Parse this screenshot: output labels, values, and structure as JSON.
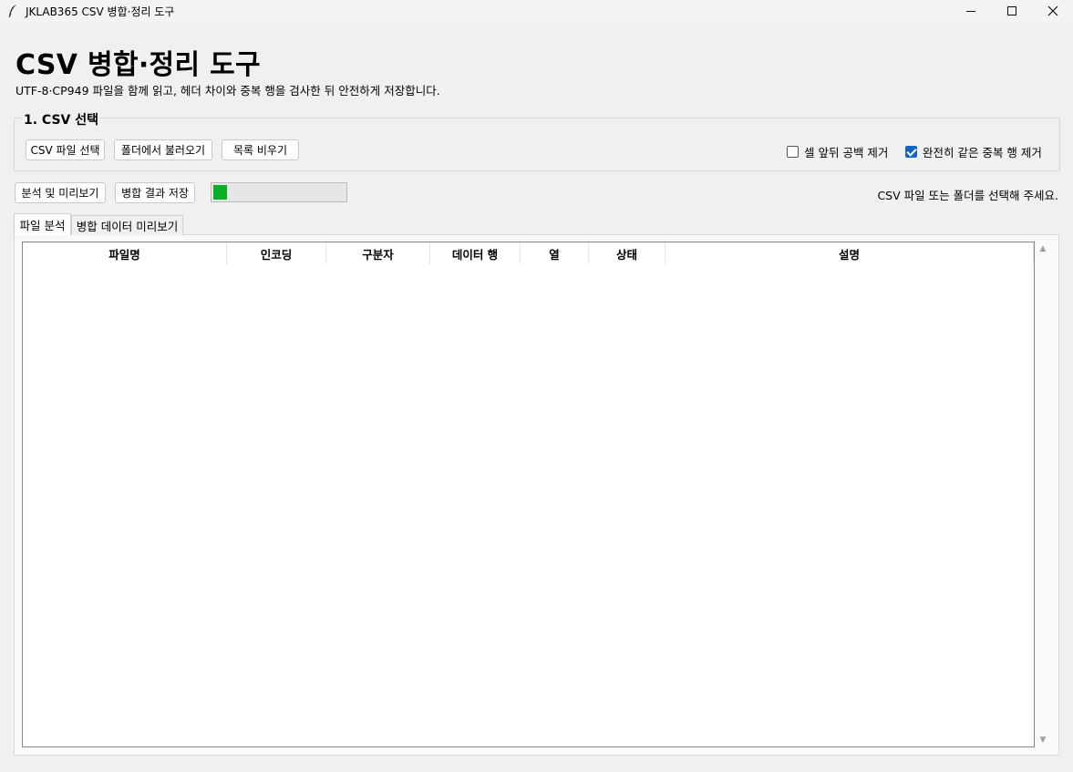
{
  "window": {
    "title": "JKLAB365 CSV 병합·정리 도구",
    "icon": "feather-icon"
  },
  "header": {
    "title": "CSV 병합·정리 도구",
    "subtitle": "UTF-8·CP949 파일을 함께 읽고, 헤더 차이와 중복 행을 검사한 뒤 안전하게 저장합니다."
  },
  "select_group": {
    "title": "1. CSV 선택",
    "buttons": {
      "select_files": "CSV 파일 선택",
      "load_folder": "폴더에서 불러오기",
      "clear_list": "목록 비우기"
    },
    "options": {
      "trim_spaces": {
        "label": "셀 앞뒤 공백 제거",
        "checked": false
      },
      "remove_duplicates": {
        "label": "완전히 같은 중복 행 제거",
        "checked": true
      }
    }
  },
  "actions": {
    "analyze": "분석 및 미리보기",
    "save": "병합 결과 저장",
    "progress": 0.1,
    "progress_color": "#06b025",
    "status": "CSV 파일 또는 폴더를 선택해 주세요."
  },
  "tabs": [
    {
      "label": "파일 분석",
      "active": true
    },
    {
      "label": "병합 데이터 미리보기",
      "active": false
    }
  ],
  "table": {
    "columns": [
      "파일명",
      "인코딩",
      "구분자",
      "데이터 행",
      "열",
      "상태",
      "설명"
    ],
    "rows": []
  }
}
